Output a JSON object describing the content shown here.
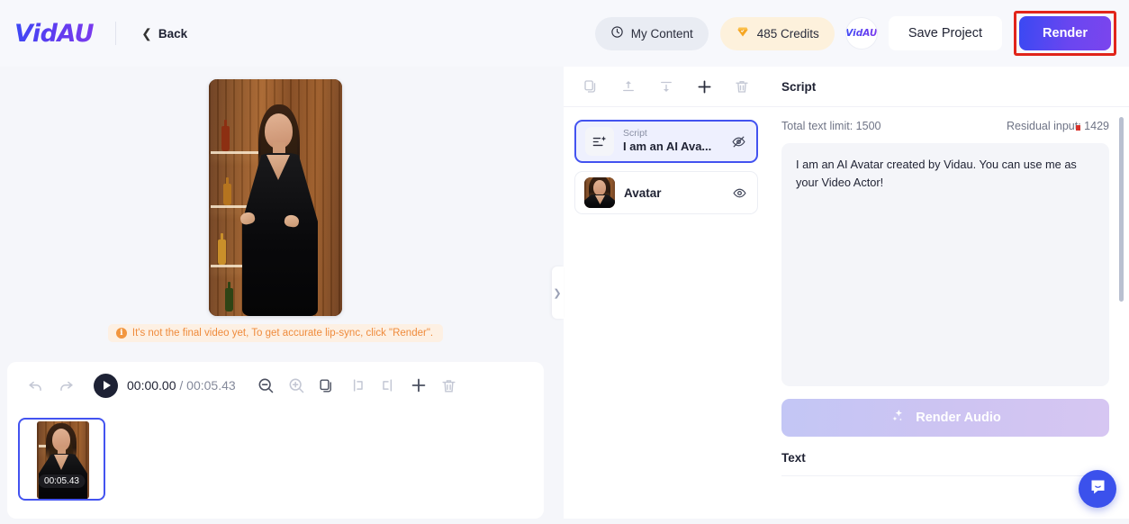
{
  "header": {
    "logo_text": "VidAU",
    "back_label": "Back",
    "my_content_label": "My Content",
    "credits_label": "485 Credits",
    "account_logo_text": "VidAU",
    "save_label": "Save Project",
    "render_label": "Render",
    "icons": {
      "clock": "clock-icon",
      "gem": "gem-icon",
      "chevron_left": "chevron-left-icon"
    },
    "colors": {
      "render_gradient_start": "#3a49f3",
      "render_gradient_end": "#7b45ee",
      "highlight_box": "#e1251b",
      "credits_pill_bg": "#fdf1dc",
      "content_pill_bg": "#e9ecf3"
    }
  },
  "canvas": {
    "warning_text": "It's not the final video yet, To get accurate lip-sync, click \"Render\".",
    "warning_icon": "info-icon",
    "warning_color": "#ef8b3c"
  },
  "timeline": {
    "undo_icon": "undo-icon",
    "redo_icon": "redo-icon",
    "play_icon": "play-icon",
    "current_time": "00:00.00",
    "time_separator": "/",
    "total_time": "00:05.43",
    "tools": [
      {
        "name": "zoom-out-icon",
        "enabled": true
      },
      {
        "name": "zoom-in-icon",
        "enabled": false
      },
      {
        "name": "duplicate-icon",
        "enabled": true
      },
      {
        "name": "split-left-icon",
        "enabled": false
      },
      {
        "name": "split-right-icon",
        "enabled": false
      },
      {
        "name": "add-icon",
        "enabled": true
      },
      {
        "name": "delete-icon",
        "enabled": false
      }
    ],
    "clip": {
      "duration_label": "00:05.43",
      "selected": true
    }
  },
  "collapse_handle": {
    "icon": "chevron-right-icon"
  },
  "layers": {
    "toolbar": [
      {
        "name": "copy-icon",
        "enabled": false
      },
      {
        "name": "bring-to-front-icon",
        "enabled": false
      },
      {
        "name": "send-to-back-icon",
        "enabled": false
      },
      {
        "name": "add-layer-icon",
        "enabled": true
      },
      {
        "name": "delete-layer-icon",
        "enabled": false
      }
    ],
    "items": [
      {
        "type": "script",
        "sub_label": "Script",
        "title": "I am an AI Ava...",
        "icon": "script-sparkle-icon",
        "visibility_icon": "eye-off-icon",
        "selected": true
      },
      {
        "type": "avatar",
        "title": "Avatar",
        "icon": "avatar-thumbnail",
        "visibility_icon": "eye-icon",
        "selected": false
      }
    ]
  },
  "script_panel": {
    "title": "Script",
    "total_limit_label": "Total text limit: 1500",
    "residual_label": "Residual input: 1429",
    "script_text": "I am an AI Avatar created by Vidau. You can use me as your Video Actor!",
    "render_audio_label": "Render Audio",
    "render_audio_icon": "sparkle-icon",
    "text_section_label": "Text",
    "scrollbar": "vertical-scrollbar"
  },
  "chat": {
    "icon": "chat-bubble-icon",
    "color": "#3b51ec"
  }
}
